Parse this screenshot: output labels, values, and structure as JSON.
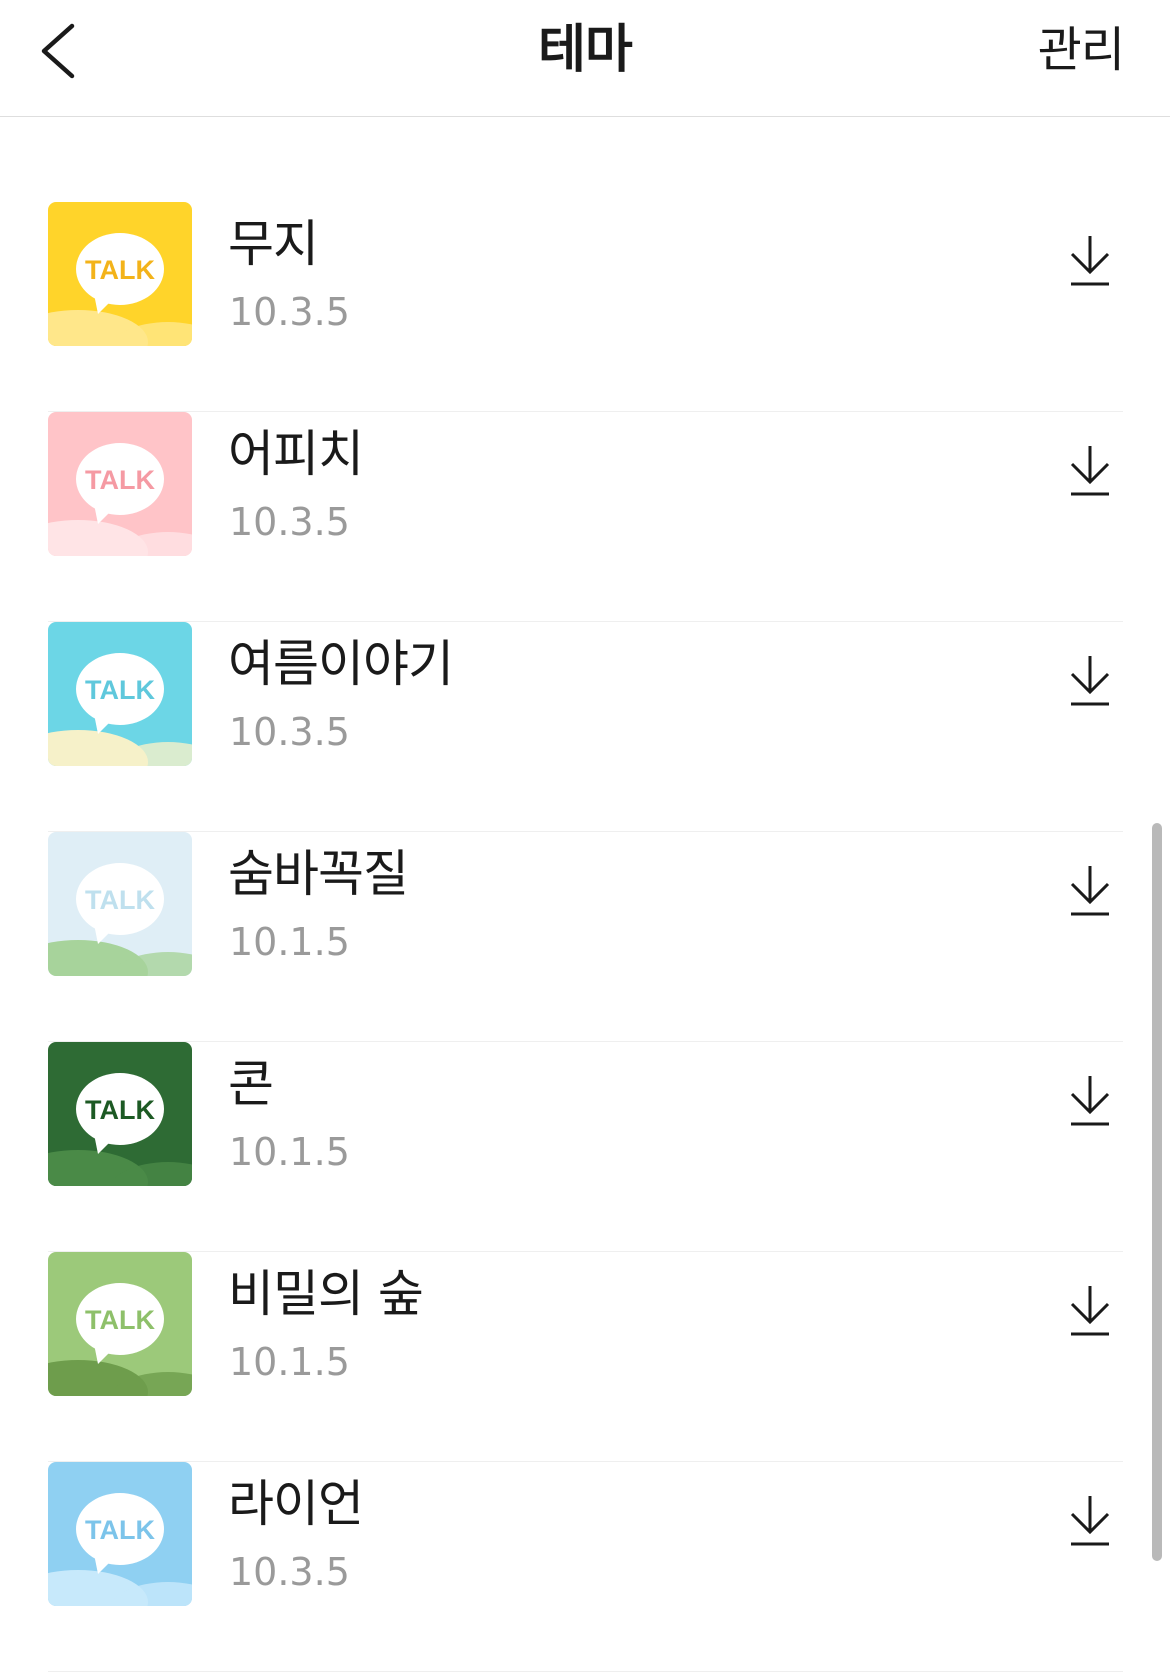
{
  "header": {
    "title": "테마",
    "manage_label": "관리"
  },
  "themes": [
    {
      "name": "무지",
      "version": "10.3.5",
      "bg": "#ffd42a",
      "accent": "#ffe78a",
      "bubble_text": "TALK",
      "text_color": "#f3b31a"
    },
    {
      "name": "어피치",
      "version": "10.3.5",
      "bg": "#ffc4c8",
      "accent": "#ffe4e6",
      "bubble_text": "TALK",
      "text_color": "#f59aa3"
    },
    {
      "name": "여름이야기",
      "version": "10.3.5",
      "bg": "#6cd6e6",
      "accent": "#f6f1c9",
      "bubble_text": "TALK",
      "text_color": "#5fc8dc"
    },
    {
      "name": "숨바꼭질",
      "version": "10.1.5",
      "bg": "#dfeef6",
      "accent": "#a7d39b",
      "bubble_text": "TALK",
      "text_color": "#bfe0ee"
    },
    {
      "name": "콘",
      "version": "10.1.5",
      "bg": "#2e6b34",
      "accent": "#4a8a47",
      "bubble_text": "TALK",
      "text_color": "#1d5a24"
    },
    {
      "name": "비밀의 숲",
      "version": "10.1.5",
      "bg": "#9cc97a",
      "accent": "#6e9d4c",
      "bubble_text": "TALK",
      "text_color": "#8ec06a"
    },
    {
      "name": "라이언",
      "version": "10.3.5",
      "bg": "#8fd0f2",
      "accent": "#c7e9fb",
      "bubble_text": "TALK",
      "text_color": "#7cc4ea"
    }
  ]
}
